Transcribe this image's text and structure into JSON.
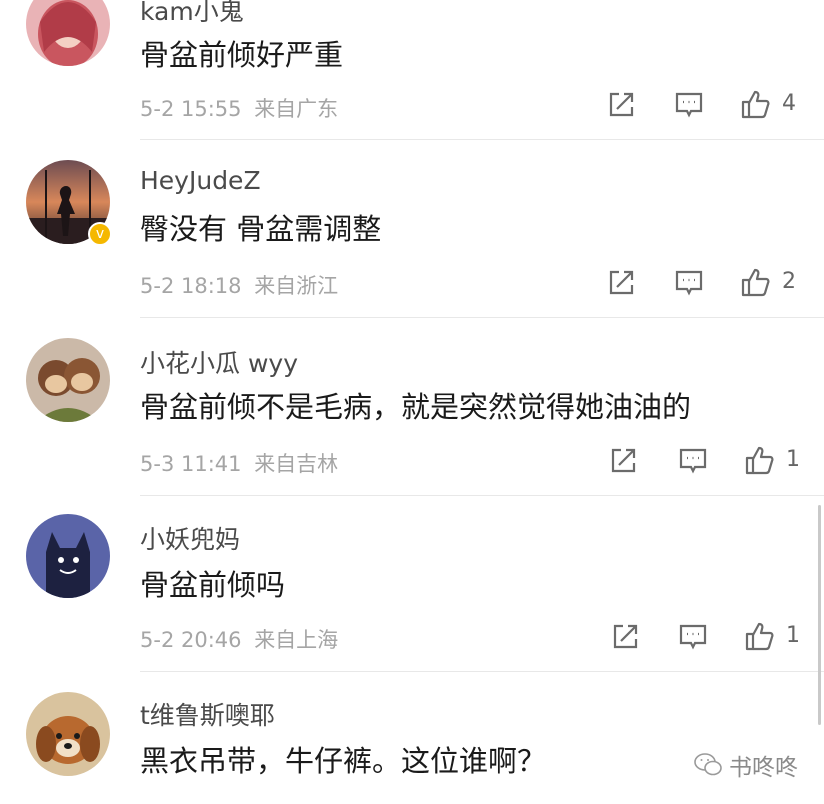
{
  "comments": [
    {
      "username": "kam小鬼",
      "text": "骨盆前倾好严重",
      "time": "5-2 15:55",
      "location": "来自广东",
      "likes": "4"
    },
    {
      "username": "HeyJudeZ",
      "text": "臀没有 骨盆需调整",
      "time": "5-2 18:18",
      "location": "来自浙江",
      "likes": "2"
    },
    {
      "username": "小花小瓜 wyy",
      "text": "骨盆前倾不是毛病，就是突然觉得她油油的",
      "time": "5-3 11:41",
      "location": "来自吉林",
      "likes": "1"
    },
    {
      "username": "小妖兜妈",
      "text": "骨盆前倾吗",
      "time": "5-2 20:46",
      "location": "来自上海",
      "likes": "1"
    },
    {
      "username": "t维鲁斯噢耶",
      "text": "黑衣吊带，牛仔裤。这位谁啊？",
      "time": "",
      "location": "",
      "likes": ""
    }
  ],
  "watermark": "书咚咚",
  "icons": {
    "share": "share-icon",
    "comment": "comment-icon",
    "like": "like-icon",
    "verified": "verified-badge-icon",
    "wechat": "wechat-icon"
  },
  "colors": {
    "text": "#1a1a1a",
    "username": "#4a4a4a",
    "meta": "#a5a5a5",
    "icon": "#6b6b6b",
    "verified": "#f5b800"
  }
}
